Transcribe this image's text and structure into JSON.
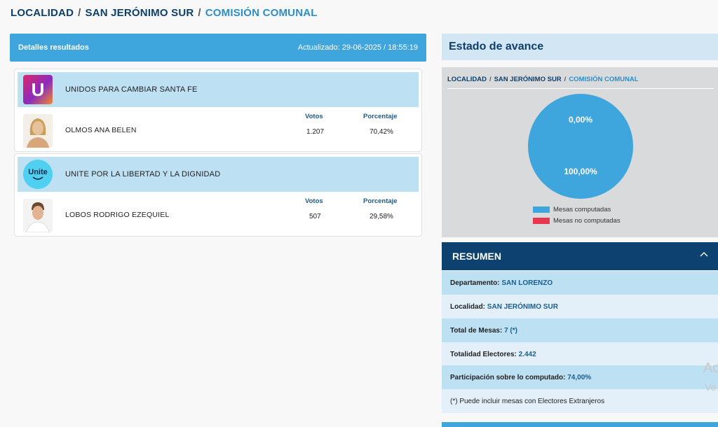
{
  "breadcrumb": {
    "level1": "LOCALIDAD",
    "sep": "/",
    "level2": "SAN JERÓNIMO SUR",
    "level3": "COMISIÓN COMUNAL"
  },
  "results": {
    "title": "Detalles resultados",
    "updated_label": "Actualizado:",
    "updated_value": "29-06-2025 / 18:55:19",
    "col_votes": "Votos",
    "col_percent": "Porcentaje",
    "parties": [
      {
        "name": "UNIDOS PARA CAMBIAR SANTA FE",
        "logo_icon": "unidos-logo-icon",
        "logo_letter": "U",
        "candidate": "OLMOS ANA BELEN",
        "avatar": "candidate-photo-female",
        "votes": "1.207",
        "percent": "70,42%"
      },
      {
        "name": "UNITE POR LA LIBERTAD Y LA DIGNIDAD",
        "logo_icon": "unite-logo-icon",
        "logo_letter": "Unite",
        "candidate": "LOBOS RODRIGO EZEQUIEL",
        "avatar": "candidate-photo-male",
        "votes": "507",
        "percent": "29,58%"
      }
    ]
  },
  "progress": {
    "title": "Estado de avance",
    "breadcrumb": {
      "level1": "LOCALIDAD",
      "sep": "/",
      "level2": "SAN JERÓNIMO SUR",
      "level3": "COMISIÓN COMUNAL"
    },
    "pie_top_label": "0,00%",
    "pie_bottom_label": "100,00%",
    "computed_fraction": 1.0,
    "legend_computed": "Mesas computadas",
    "legend_not_computed": "Mesas no computadas",
    "color_computed": "#3fa5dd",
    "color_not_computed": "#e8384f"
  },
  "summary": {
    "title": "RESUMEN",
    "rows": [
      {
        "label": "Departamento:",
        "value": "SAN LORENZO"
      },
      {
        "label": "Localidad:",
        "value": "SAN JERÓNIMO SUR"
      },
      {
        "label": "Total de Mesas:",
        "value": "7 (*)"
      },
      {
        "label": "Totalidad Electores:",
        "value": "2.442"
      },
      {
        "label": "Participación sobre lo computado:",
        "value": "74,00%"
      }
    ],
    "note": "(*) Puede incluir mesas con Electores Extranjeros"
  },
  "overlay": {
    "line1": "Ac",
    "line2": "Ve"
  }
}
